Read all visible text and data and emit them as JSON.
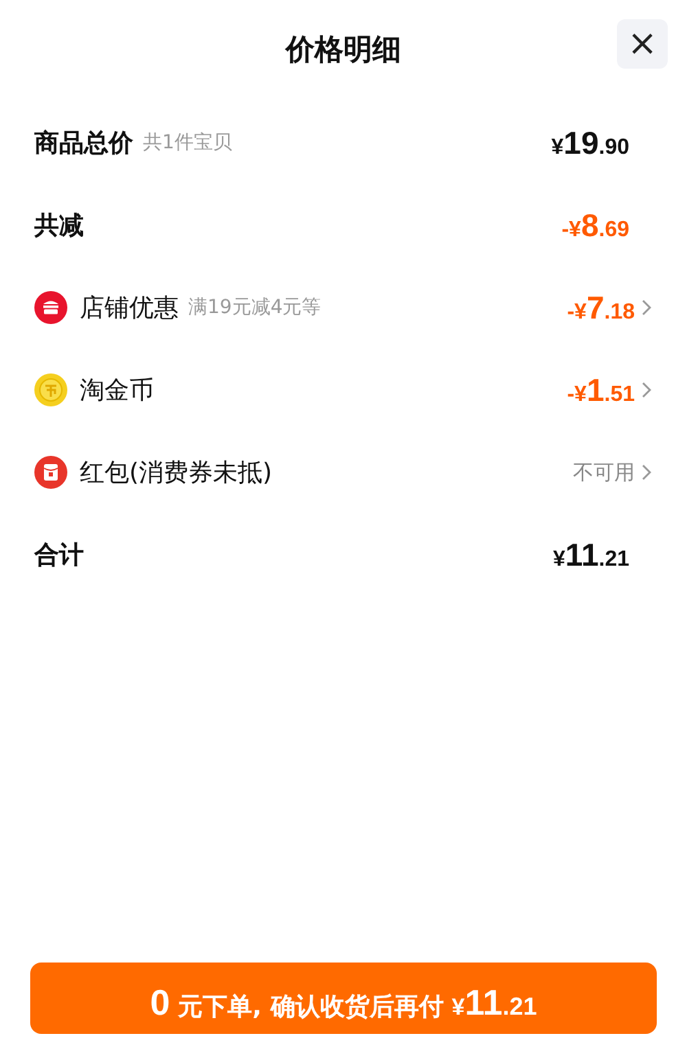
{
  "header": {
    "title": "价格明细",
    "close": "×"
  },
  "rows": [
    {
      "kind": "subtotal",
      "label": "商品总价",
      "note": "共1件宝贝",
      "value": {
        "prefix": "¥",
        "whole": "19",
        "fraction": ".90"
      }
    },
    {
      "kind": "saving",
      "label": "共减",
      "value": {
        "prefix": "-¥",
        "whole": "8",
        "fraction": ".69"
      }
    },
    {
      "kind": "store_discount",
      "label": "店铺优惠",
      "note": "满19元减4元等",
      "value": {
        "prefix": "-¥",
        "whole": "7",
        "fraction": ".18"
      }
    },
    {
      "kind": "coin_discount",
      "label": "淘金币",
      "value": {
        "prefix": "-¥",
        "whole": "1",
        "fraction": ".51"
      }
    },
    {
      "kind": "voucher",
      "label": "红包(消费券未抵)",
      "status": "不可用"
    },
    {
      "kind": "total",
      "label": "合计",
      "value": {
        "prefix": "¥",
        "whole": "11",
        "fraction": ".21"
      }
    }
  ],
  "button": {
    "lead": "0",
    "middle": "元下单, 确认收货后再付",
    "prefix": "¥",
    "whole": "11",
    "fraction": ".21"
  }
}
